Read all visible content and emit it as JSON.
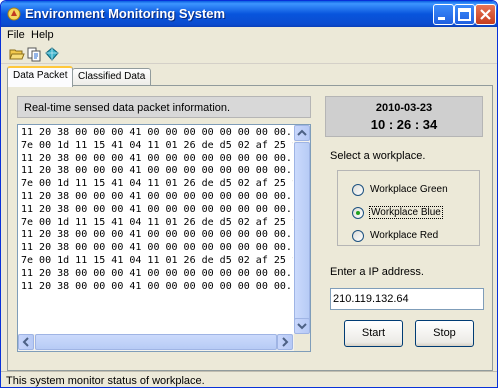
{
  "window": {
    "title": "Environment Monitoring System"
  },
  "menu": {
    "file": "File",
    "help": "Help"
  },
  "tabs": [
    {
      "label": "Data Packet"
    },
    {
      "label": "Classified Data"
    }
  ],
  "info": {
    "text": "Real-time sensed data packet information."
  },
  "packets": [
    "11 20 38 00 00 00 41 00 00 00 00 00 00 00 00...",
    "7e 00 1d 11 15 41 04 11 01 26 de d5 02 af 25 f5...",
    "11 20 38 00 00 00 41 00 00 00 00 00 00 00 00...",
    "11 20 38 00 00 00 41 00 00 00 00 00 00 00 00...",
    "7e 00 1d 11 15 41 04 11 01 26 de d5 02 af 25 f5...",
    "11 20 38 00 00 00 41 00 00 00 00 00 00 00 00...",
    "11 20 38 00 00 00 41 00 00 00 00 00 00 00 00...",
    "7e 00 1d 11 15 41 04 11 01 26 de d5 02 af 25 f5...",
    "11 20 38 00 00 00 41 00 00 00 00 00 00 00 00...",
    "11 20 38 00 00 00 41 00 00 00 00 00 00 00 00...",
    "7e 00 1d 11 15 41 04 11 01 26 de d5 02 af 25 f5...",
    "11 20 38 00 00 00 41 00 00 00 00 00 00 00 00...",
    "11 20 38 00 00 00 41 00 00 00 00 00 00 00 00..."
  ],
  "clock": {
    "date": "2010-03-23",
    "time": "10 : 26 : 34"
  },
  "workplace": {
    "label": "Select a workplace.",
    "options": [
      {
        "label": "Workplace Green",
        "selected": false
      },
      {
        "label": "Workplace Blue",
        "selected": true
      },
      {
        "label": "Workplace Red",
        "selected": false
      }
    ]
  },
  "ip": {
    "label": "Enter a IP address.",
    "value": "210.119.132.64"
  },
  "buttons": {
    "start": "Start",
    "stop": "Stop"
  },
  "status": {
    "text": "This system monitor status of workplace."
  },
  "colors": {
    "titlebar": "#0855dd",
    "accent_tab": "#ffc83c",
    "radio_dot": "#21a121"
  },
  "icons": {
    "toolbar": [
      "open-folder-icon",
      "copy-icon",
      "gem-icon"
    ]
  }
}
